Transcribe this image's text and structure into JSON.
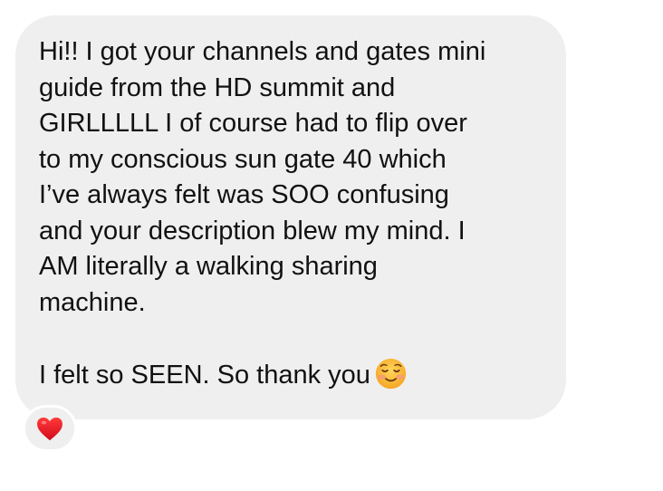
{
  "message": {
    "lines_paragraph_1": [
      "Hi!! I got your channels and gates mini",
      "guide from the HD summit and",
      "GIRLLLLL I of course had to flip over",
      "to my conscious sun gate 40 which",
      "I’ve always felt was SOO confusing",
      "and your description blew my mind. I",
      "AM literally a walking sharing",
      "machine."
    ],
    "paragraph_2": "I felt so SEEN. So thank you",
    "emoji": "smiling-face-with-blush",
    "bubble_color": "#efefef"
  },
  "reaction": {
    "icon": "red-heart",
    "color": "#e8111e"
  }
}
